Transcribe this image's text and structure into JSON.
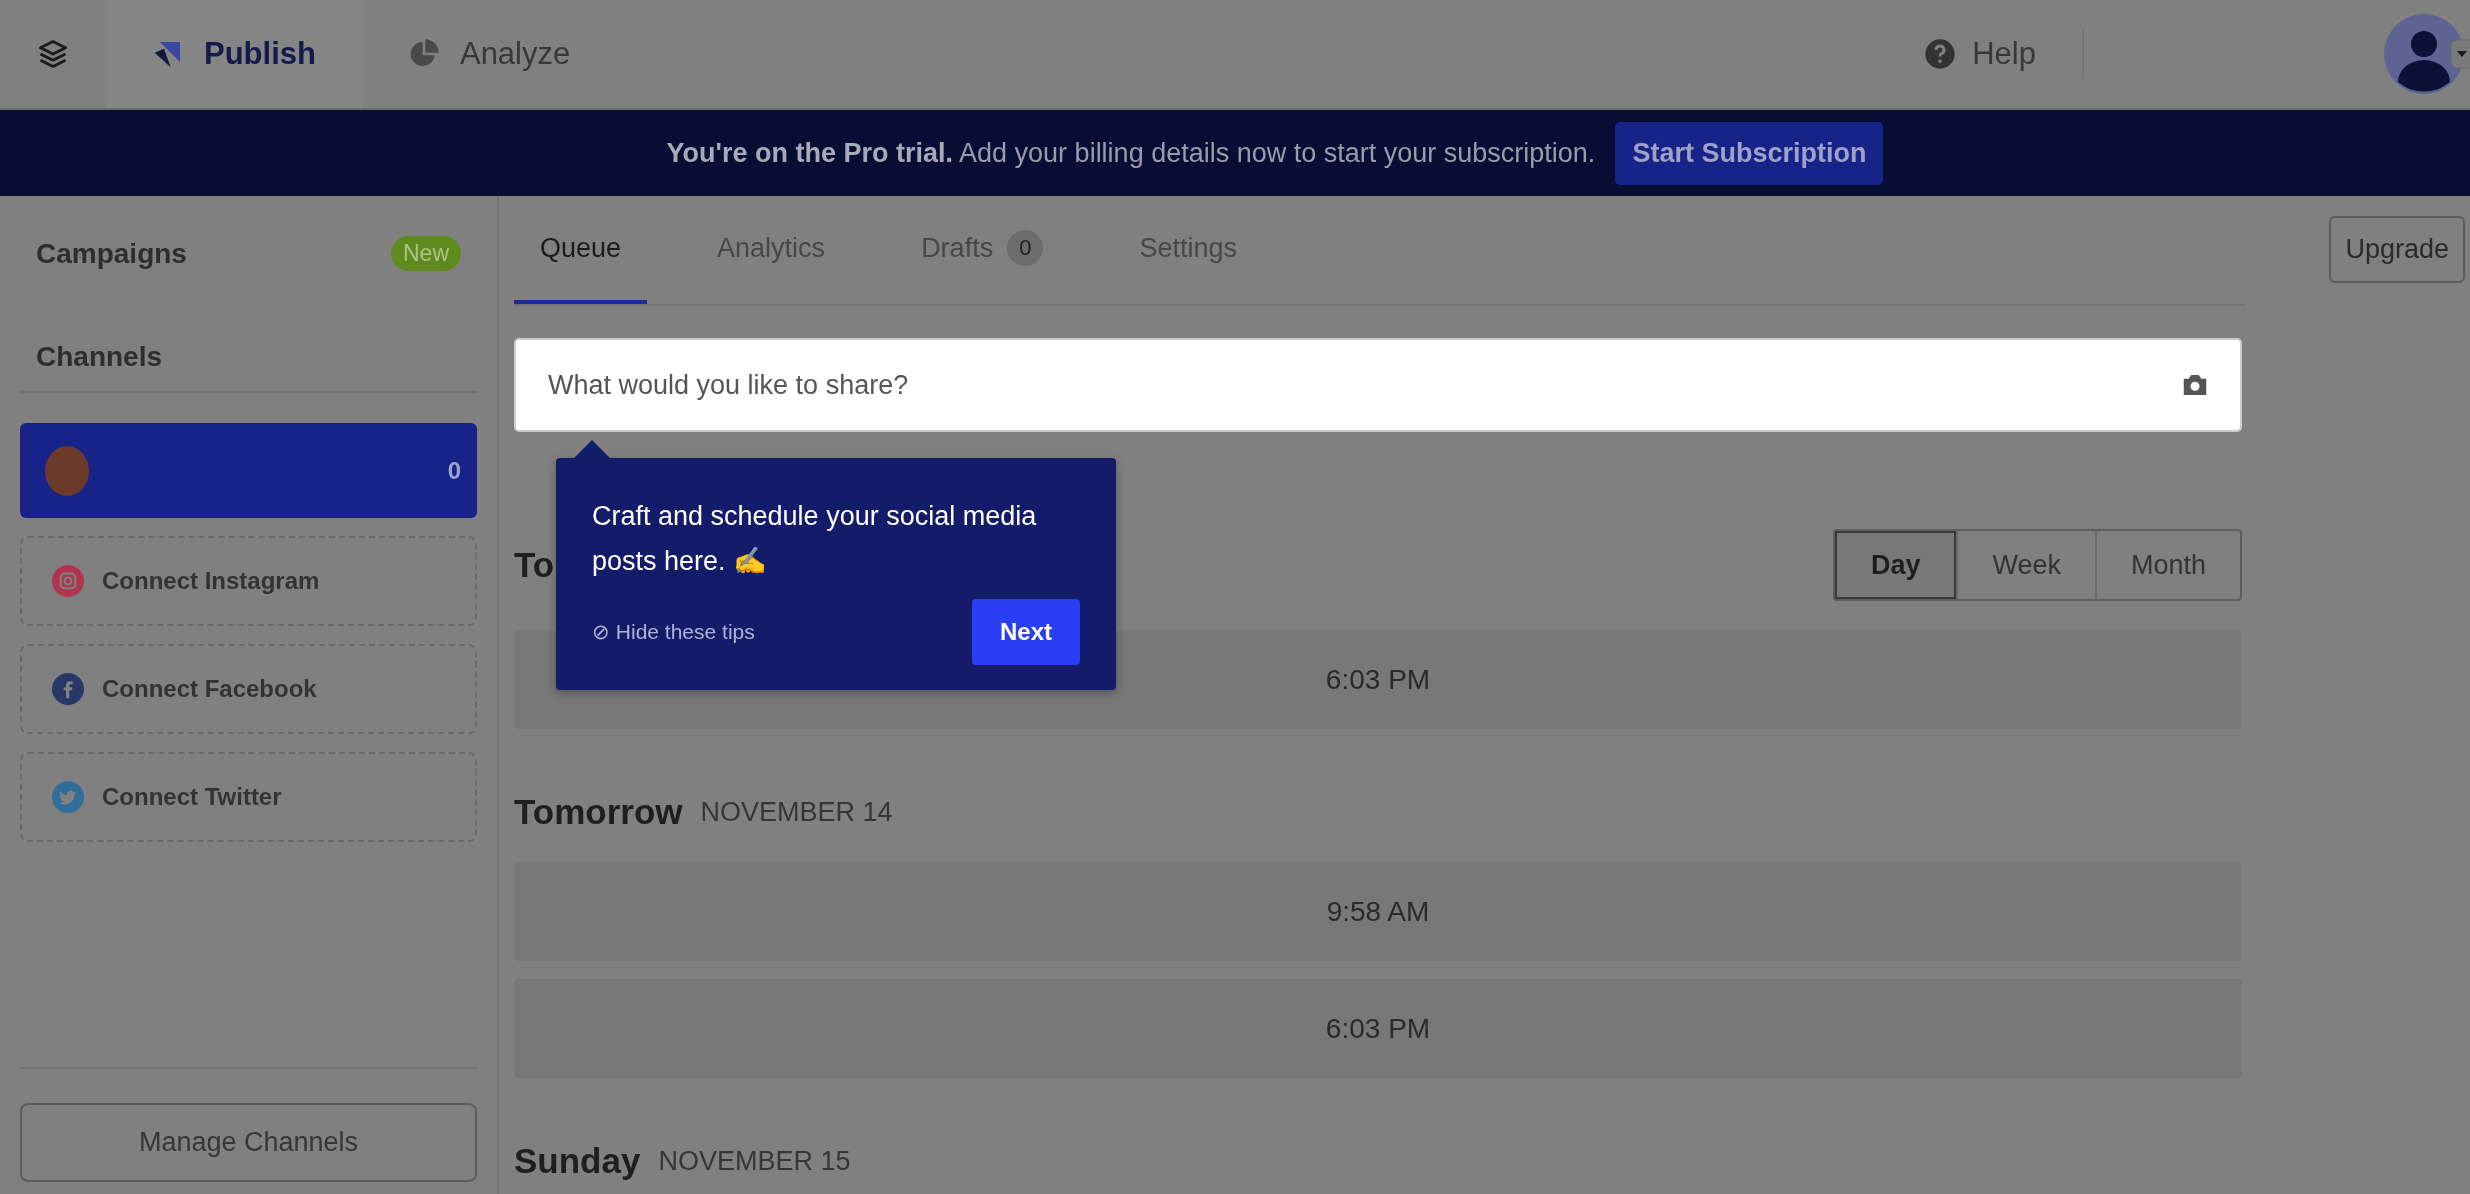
{
  "nav": {
    "tabs": [
      {
        "label": "Publish",
        "kind": "publish",
        "selected": true
      },
      {
        "label": "Analyze",
        "kind": "analyze",
        "selected": false
      }
    ],
    "help": "Help"
  },
  "banner": {
    "message": "**You're on the Pro trial.** Add your billing details now to start your subscription.",
    "button": "Start Subscription"
  },
  "sidebar": {
    "campaigns": "Campaigns",
    "campaigns_badge": "New",
    "channels_heading": "Channels",
    "channels": [
      {
        "count": "0",
        "selected": true
      }
    ],
    "connect": [
      {
        "label": "Connect Instagram",
        "kind": "instagram",
        "color": "#b2334f"
      },
      {
        "label": "Connect Facebook",
        "kind": "facebook",
        "color": "#283766"
      },
      {
        "label": "Connect Twitter",
        "kind": "twitter",
        "color": "#2d6f99"
      }
    ],
    "manage_button": "Manage Channels"
  },
  "main": {
    "tabs": [
      {
        "label": "Queue",
        "selected": true
      },
      {
        "label": "Analytics",
        "selected": false
      },
      {
        "label": "Drafts",
        "count": "0",
        "selected": false
      },
      {
        "label": "Settings",
        "selected": false
      }
    ],
    "upgrade": "Upgrade",
    "composer": {
      "placeholder": "What would you like to share?"
    },
    "range": [
      {
        "label": "Day",
        "selected": true
      },
      {
        "label": "Week",
        "selected": false
      },
      {
        "label": "Month",
        "selected": false
      }
    ],
    "days": [
      {
        "title": "To",
        "slots": [
          "6:03 PM"
        ]
      },
      {
        "title": "Tomorrow",
        "date": "NOVEMBER 14",
        "slots": [
          "9:58 AM",
          "6:03 PM"
        ]
      },
      {
        "title": "Sunday",
        "date": "NOVEMBER 15"
      }
    ]
  },
  "tip": {
    "text": "Craft and schedule your social media posts here. ✍️",
    "hide": "⊘ Hide these tips",
    "next": "Next"
  }
}
